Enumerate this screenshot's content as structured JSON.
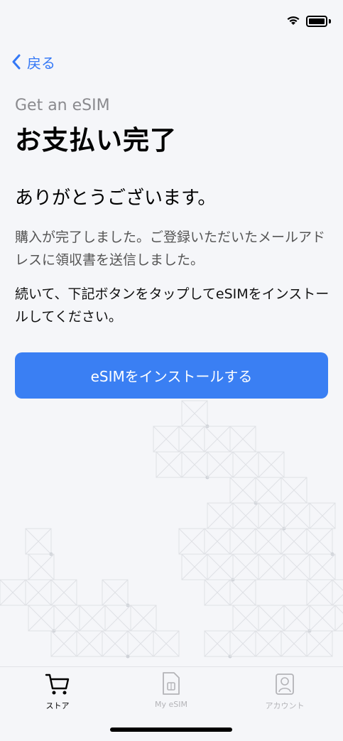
{
  "nav": {
    "back_label": "戻る"
  },
  "header": {
    "subtitle": "Get an eSIM",
    "title": "お支払い完了"
  },
  "content": {
    "thanks": "ありがとうございます。",
    "paragraph1": "購入が完了しました。ご登録いただいたメールアドレスに領収書を送信しました。",
    "paragraph2": "続いて、下記ボタンをタップしてeSIMをインストールしてください。",
    "install_button_label": "eSIMをインストールする"
  },
  "tabbar": {
    "tabs": [
      {
        "label": "ストア",
        "icon": "cart-icon",
        "active": true
      },
      {
        "label": "My eSIM",
        "icon": "sim-card-icon",
        "active": false
      },
      {
        "label": "アカウント",
        "icon": "account-icon",
        "active": false
      }
    ]
  },
  "colors": {
    "accent": "#3a7ff3",
    "background": "#f5f6f9",
    "inactive_tab": "#b4b4b8"
  }
}
